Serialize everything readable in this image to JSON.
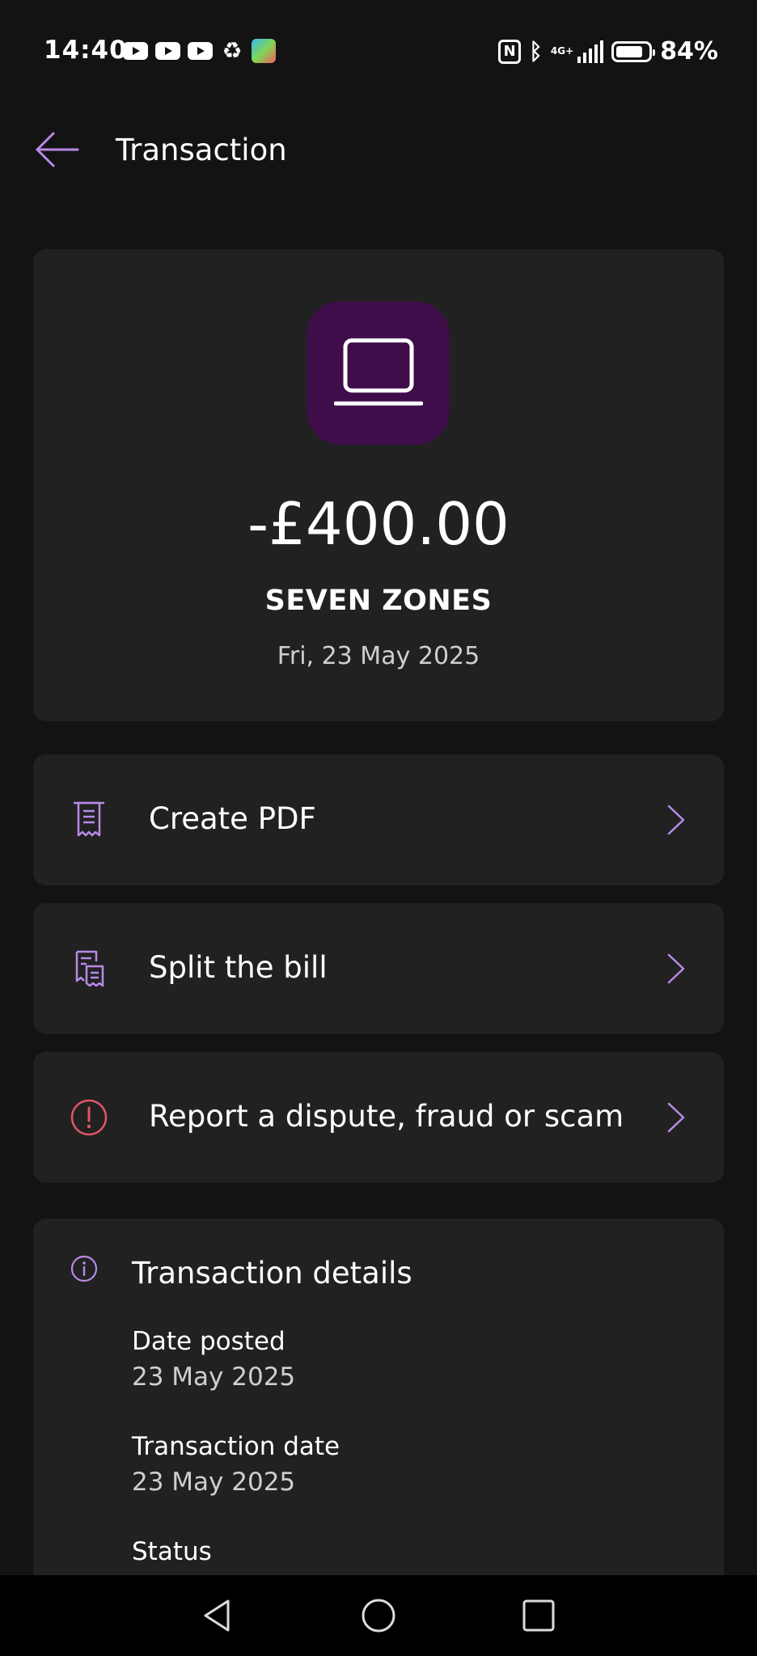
{
  "status_bar": {
    "time": "14:40",
    "battery_percent": "84%",
    "battery_level": 0.84,
    "network": "4G+",
    "icons_left": [
      "youtube-icon",
      "youtube-icon",
      "youtube-icon",
      "recycle-icon",
      "app-notification-icon"
    ],
    "icons_right": [
      "nfc-icon",
      "bluetooth-icon",
      "signal-icon",
      "battery-icon"
    ]
  },
  "header": {
    "title": "Transaction",
    "back_icon": "arrow-left-icon"
  },
  "summary": {
    "icon": "laptop-icon",
    "amount": "-£400.00",
    "merchant": "SEVEN ZONES",
    "date": "Fri, 23 May 2025"
  },
  "actions": [
    {
      "label": "Create PDF",
      "icon": "receipt-icon"
    },
    {
      "label": "Split the bill",
      "icon": "split-receipt-icon"
    },
    {
      "label": "Report a dispute, fraud or scam",
      "icon": "alert-circle-icon"
    }
  ],
  "details": {
    "title": "Transaction details",
    "rows": [
      {
        "label": "Date posted",
        "value": "23 May 2025"
      },
      {
        "label": "Transaction date",
        "value": "23 May 2025"
      },
      {
        "label": "Status",
        "value": ""
      }
    ]
  },
  "nav_bar": {
    "buttons": [
      "back-triangle-icon",
      "home-circle-icon",
      "recents-square-icon"
    ]
  },
  "colors": {
    "background": "#131313",
    "card": "#212121",
    "accent": "#b88ae8",
    "icon_tile": "#3f0e4a",
    "alert": "#e0566a"
  }
}
